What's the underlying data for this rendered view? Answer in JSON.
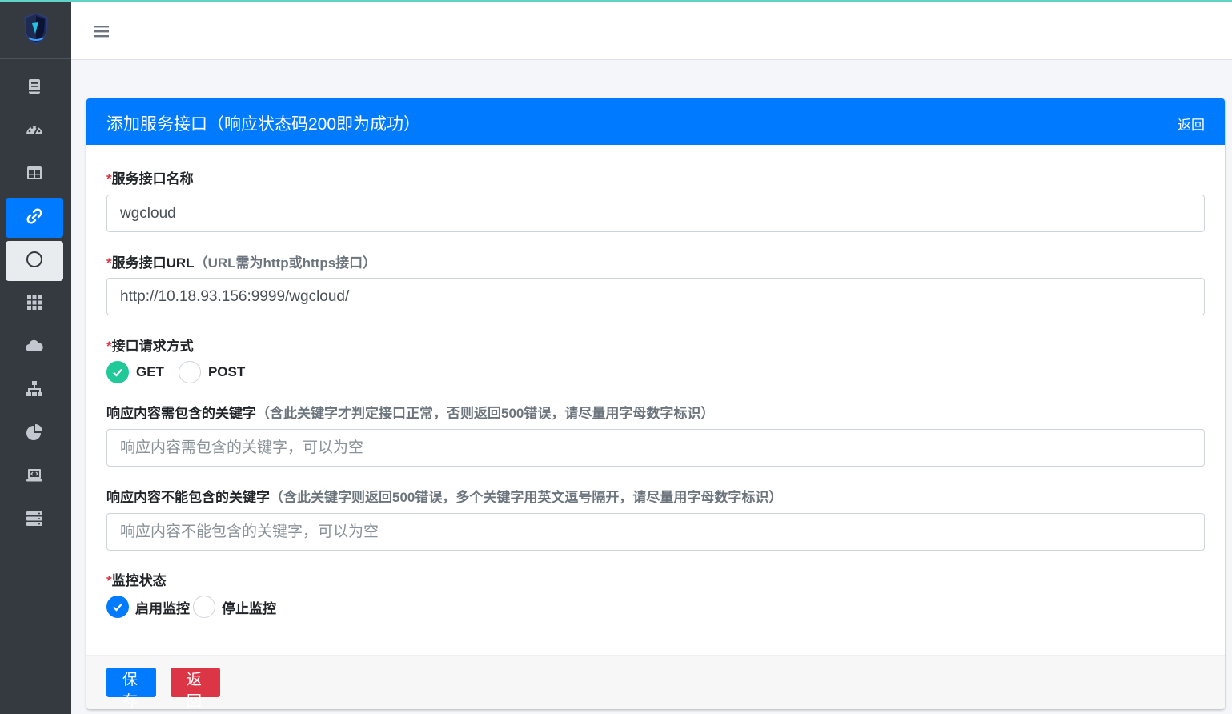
{
  "header": {
    "menu_icon": "hamburger-icon"
  },
  "sidebar": {
    "logo_icon": "shield-logo-icon",
    "items": [
      {
        "icon": "book-icon"
      },
      {
        "icon": "dashboard-gauge-icon"
      },
      {
        "icon": "table-icon"
      },
      {
        "icon": "link-icon",
        "active": true
      },
      {
        "icon": "circle-icon"
      },
      {
        "icon": "grid-icon"
      },
      {
        "icon": "cloud-icon"
      },
      {
        "icon": "network-icon"
      },
      {
        "icon": "pie-chart-icon"
      },
      {
        "icon": "laptop-code-icon"
      },
      {
        "icon": "server-icon"
      }
    ]
  },
  "card": {
    "title": "添加服务接口（响应状态码200即为成功）",
    "back_link": "返回"
  },
  "form": {
    "required_mark": "*",
    "name": {
      "label": "服务接口名称",
      "value": "wgcloud"
    },
    "url": {
      "label": "服务接口URL",
      "hint": "（URL需为http或https接口）",
      "value": "http://10.18.93.156:9999/wgcloud/"
    },
    "method": {
      "label": "接口请求方式",
      "options": [
        "GET",
        "POST"
      ],
      "selected": "GET"
    },
    "include_keyword": {
      "label": "响应内容需包含的关键字",
      "hint": "（含此关键字才判定接口正常，否则返回500错误，请尽量用字母数字标识）",
      "placeholder": "响应内容需包含的关键字，可以为空"
    },
    "exclude_keyword": {
      "label": "响应内容不能包含的关键字",
      "hint": "（含此关键字则返回500错误，多个关键字用英文逗号隔开，请尽量用字母数字标识）",
      "placeholder": "响应内容不能包含的关键字，可以为空"
    },
    "monitor": {
      "label": "监控状态",
      "options": [
        "启用监控",
        "停止监控"
      ],
      "selected": "启用监控"
    }
  },
  "footer": {
    "save_label": "保存",
    "back_label": "返回"
  },
  "colors": {
    "primary": "#007bff",
    "danger": "#dc3545",
    "success": "#20c997",
    "sidebar": "#343a40"
  }
}
